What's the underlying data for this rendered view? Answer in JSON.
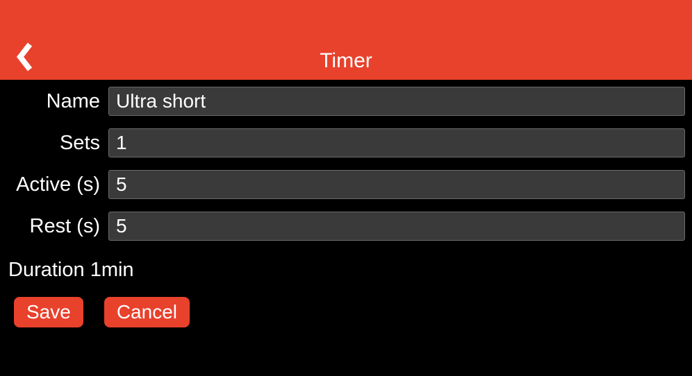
{
  "header": {
    "title": "Timer"
  },
  "form": {
    "name": {
      "label": "Name",
      "value": "Ultra short"
    },
    "sets": {
      "label": "Sets",
      "value": "1"
    },
    "active": {
      "label": "Active (s)",
      "value": "5"
    },
    "rest": {
      "label": "Rest (s)",
      "value": "5"
    }
  },
  "duration": {
    "label": "Duration",
    "value": "1min"
  },
  "buttons": {
    "save": "Save",
    "cancel": "Cancel"
  }
}
